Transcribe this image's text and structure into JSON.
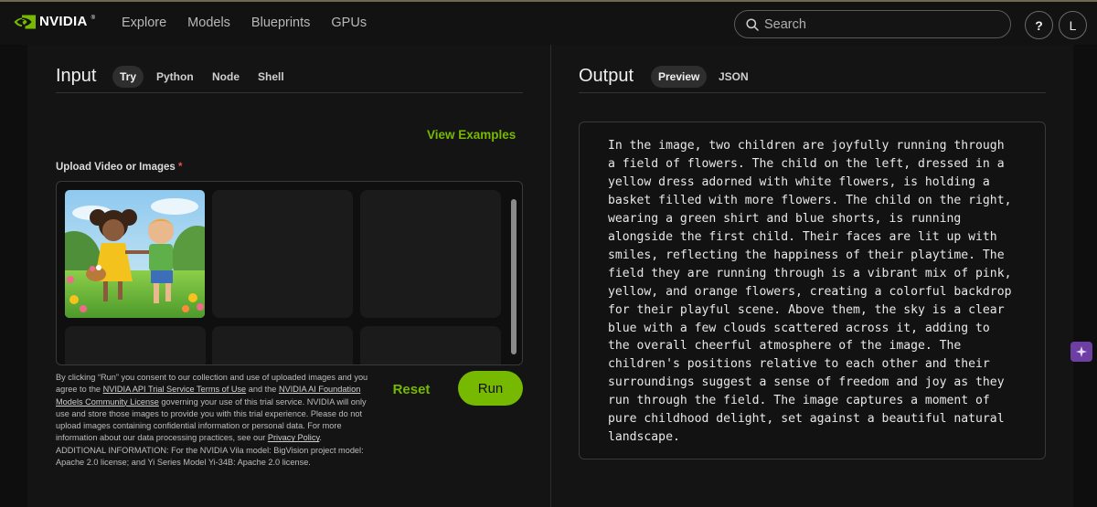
{
  "brand": {
    "name": "NVIDIA",
    "accent": "#76b900"
  },
  "nav": {
    "links": [
      "Explore",
      "Models",
      "Blueprints",
      "GPUs"
    ],
    "search_placeholder": "Search",
    "help_label": "?",
    "user_initial": "L"
  },
  "input_panel": {
    "title": "Input",
    "tabs": [
      "Try",
      "Python",
      "Node",
      "Shell"
    ],
    "active_tab": "Try",
    "view_examples": "View Examples",
    "upload_label": "Upload Video or Images",
    "required_marker": "*",
    "legal": {
      "p1": "By clicking “Run” you consent to our collection and use of uploaded images and you agree to the ",
      "link1": "NVIDIA API Trial Service Terms of Use",
      "p2": " and the ",
      "link2": "NVIDIA AI Foundation Models Community License",
      "p3": " governing your use of this trial service. NVIDIA will only use and store those images to provide you with this trial experience. Please do not upload images containing confidential information or personal data. For more information about our data processing practices, see our ",
      "link3": "Privacy Policy",
      "p4": ". ADDITIONAL INFORMATION: For the NVIDIA Vila model: BigVision project model: Apache 2.0 license; and Yi Series Model Yi-34B: Apache 2.0 license."
    },
    "reset_label": "Reset",
    "run_label": "Run"
  },
  "output_panel": {
    "title": "Output",
    "tabs": [
      "Preview",
      "JSON"
    ],
    "active_tab": "Preview",
    "text": "In the image, two children are joyfully running through\na field of flowers. The child on the left, dressed in a\nyellow dress adorned with white flowers, is holding a\nbasket filled with more flowers. The child on the right,\nwearing a green shirt and blue shorts, is running\nalongside the first child. Their faces are lit up with\nsmiles, reflecting the happiness of their playtime. The\nfield they are running through is a vibrant mix of pink,\nyellow, and orange flowers, creating a colorful backdrop\nfor their playful scene. Above them, the sky is a clear\nblue with a few clouds scattered across it, adding to\nthe overall cheerful atmosphere of the image. The\nchildren's positions relative to each other and their\nsurroundings suggest a sense of freedom and joy as they\nrun through the field. The image captures a moment of\npure childhood delight, set against a beautiful natural\nlandscape."
  }
}
